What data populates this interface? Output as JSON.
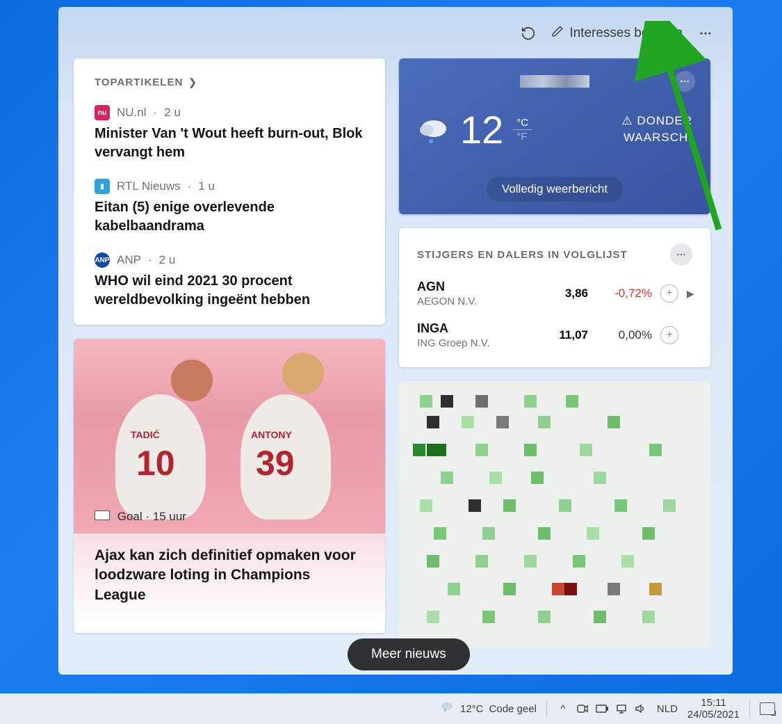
{
  "topbar": {
    "manage_interests": "Interesses beheren"
  },
  "top_articles": {
    "title": "TOPARTIKELEN",
    "items": [
      {
        "source": "NU.nl",
        "time": "2 u",
        "headline": "Minister Van 't Wout heeft burn-out, Blok vervangt hem"
      },
      {
        "source": "RTL Nieuws",
        "time": "1 u",
        "headline": "Eitan (5) enige overlevende kabelbaandrama"
      },
      {
        "source": "ANP",
        "time": "2 u",
        "headline": "WHO wil eind 2021 30 procent wereldbevolking ingeënt hebben"
      }
    ]
  },
  "weather": {
    "temp": "12",
    "unit_c": "°C",
    "unit_f": "°F",
    "warn_line1": "DONDER",
    "warn_line2": "WAARSCH.",
    "full_report": "Volledig weerbericht"
  },
  "stocks": {
    "title": "STIJGERS EN DALERS IN VOLGLIJST",
    "rows": [
      {
        "symbol": "AGN",
        "company": "AEGON N.V.",
        "price": "3,86",
        "pct": "-0,72%",
        "pct_class": "neg"
      },
      {
        "symbol": "INGA",
        "company": "ING Groep N.V.",
        "price": "11,07",
        "pct": "0,00%",
        "pct_class": "zero"
      }
    ]
  },
  "sports": {
    "source": "Goal",
    "time": "15 uur",
    "headline": "Ajax kan zich definitief opmaken voor loodzware loting in Champions League",
    "jersey1_name": "TADIĆ",
    "jersey1_num": "10",
    "jersey2_name": "ANTONY",
    "jersey2_num": "39"
  },
  "more_news": "Meer nieuws",
  "taskbar": {
    "temp": "12°C",
    "condition": "Code geel",
    "lang": "NLD",
    "time": "15:11",
    "date": "24/05/2021"
  }
}
